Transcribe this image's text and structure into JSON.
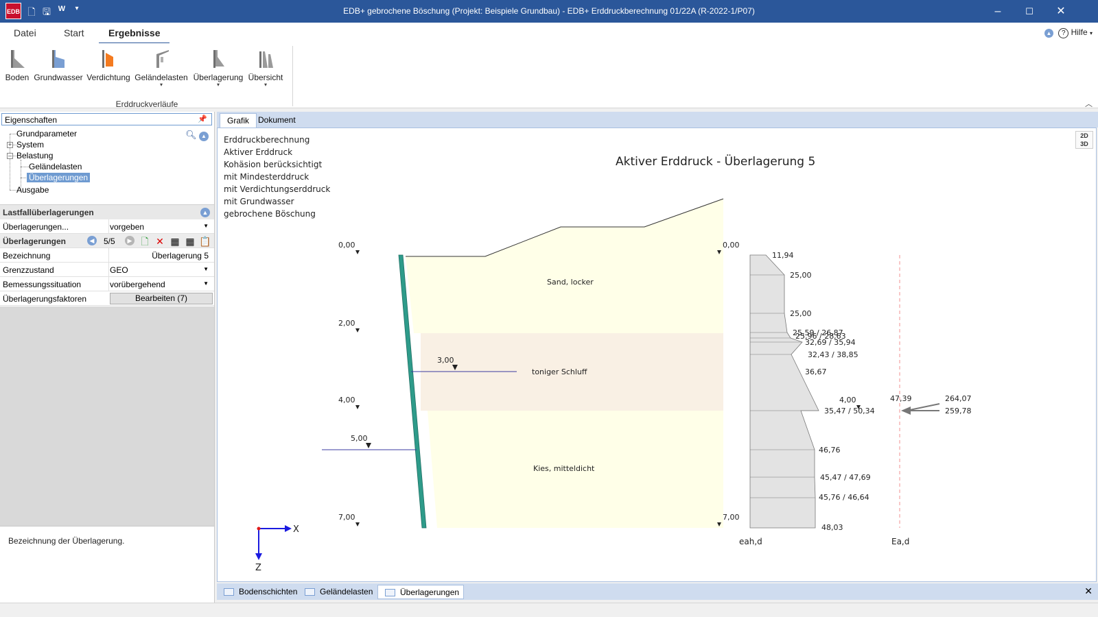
{
  "window": {
    "title": "EDB+ gebrochene Böschung (Projekt: Beispiele Grundbau) - EDB+ Erddruckberechnung 01/22A (R-2022-1/P07)",
    "logo": "EDB"
  },
  "menu": {
    "tabs": [
      "Datei",
      "Start",
      "Ergebnisse"
    ],
    "help": "Hilfe"
  },
  "ribbon": {
    "buttons": [
      "Boden",
      "Grundwasser",
      "Verdichtung",
      "Geländelasten",
      "Überlagerung",
      "Übersicht"
    ],
    "group": "Erddruckverläufe"
  },
  "properties": {
    "header": "Eigenschaften",
    "tree": [
      "Grundparameter",
      "System",
      "Belastung",
      "Geländelasten",
      "Überlagerungen",
      "Ausgabe"
    ]
  },
  "lastfall": {
    "section": "Lastfallüberlagerungen",
    "rows": {
      "ueberlagerungen_mode_label": "Überlagerungen...",
      "ueberlagerungen_mode_value": "vorgeben",
      "ueberlagerungen_label": "Überlagerungen",
      "counter": "5/5",
      "bezeichnung_label": "Bezeichnung",
      "bezeichnung_value": "Überlagerung 5",
      "grenzzustand_label": "Grenzzustand",
      "grenzzustand_value": "GEO",
      "bemessung_label": "Bemessungssituation",
      "bemessung_value": "vorübergehend",
      "faktoren_label": "Überlagerungsfaktoren",
      "faktoren_button": "Bearbeiten (7)"
    },
    "description": "Bezeichnung der Überlagerung."
  },
  "doc_tabs": [
    "Grafik",
    "Dokument"
  ],
  "graphic": {
    "info_lines": [
      "Erddruckberechnung",
      "Aktiver Erddruck",
      "Kohäsion berücksichtigt",
      "mit Mindesterddruck",
      "mit Verdichtungserddruck",
      "mit Grundwasser",
      "gebrochene Böschung"
    ],
    "title": "Aktiver Erddruck - Überlagerung 5",
    "soils": [
      "Sand, locker",
      "toniger Schluff",
      "Kies, mitteldicht"
    ],
    "left_depths": [
      "0,00",
      "2,00",
      "4,00",
      "7,00"
    ],
    "right_depths": [
      "0,00",
      "7,00"
    ],
    "water_levels": [
      "3,00",
      "5,00"
    ],
    "pressure_labels": [
      "11,94",
      "25,00",
      "25,00",
      "25,59 / 26,87",
      "25,96 / 28,63",
      "32,69 / 35,94",
      "32,43 / 38,85",
      "36,67",
      "4,00",
      "35,47 / 50,34",
      "46,76",
      "45,47 / 47,69",
      "45,76 / 46,64",
      "48,03"
    ],
    "resultant_labels": [
      "47,39",
      "264,07",
      "259,78"
    ],
    "axis_labels": {
      "eah": "eah,d",
      "ea": "Ea,d",
      "x": "X",
      "z": "Z"
    },
    "colors": {
      "sand": "#ffffe8",
      "schluff": "#f9f0e4",
      "wall": "#2e9b8a",
      "water": "#3a3aa0",
      "pressure": "#e0e0e0"
    }
  },
  "bottom_tabs": [
    "Bodenschichten",
    "Geländelasten",
    "Überlagerungen"
  ]
}
